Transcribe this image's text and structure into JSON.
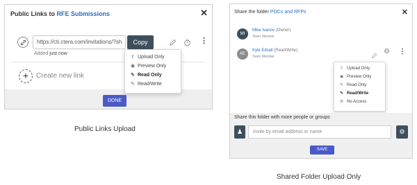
{
  "left": {
    "title_prefix": "Public Links to ",
    "title_link": "RFE Submissions",
    "url": "https://cti.ctera.com/invitations/?sh",
    "copy_label": "Copy",
    "added_prefix": "Added ",
    "added_when": "just now",
    "create_label": "Create new link",
    "menu": [
      "Upload Only",
      "Preview Only",
      "Read Only",
      "Read/Write"
    ],
    "done_label": "DONE"
  },
  "right": {
    "title_prefix": "Share the folder ",
    "title_link": "POCs and RFPs",
    "users": [
      {
        "initials": "MI",
        "name": "Mike Ivanov",
        "role": "(Owner)",
        "sub": "Team Member"
      },
      {
        "initials": "KE",
        "name": "Kyle Edsall",
        "role": "(Read/Write)",
        "sub": "Team Member"
      }
    ],
    "menu": [
      "Upload Only",
      "Preview Only",
      "Read Only",
      "Read/Write",
      "No Access"
    ],
    "share_label": "Share this folder with more people or groups",
    "invite_placeholder": "Invite by email address or name",
    "save_label": "SAVE"
  },
  "captions": {
    "left": "Public Links Upload",
    "right": "Shared Folder Upload Only"
  },
  "colors": {
    "accent": "#4a5ac8",
    "link": "#2a6ebb",
    "dark_button": "#3d4f5c"
  }
}
